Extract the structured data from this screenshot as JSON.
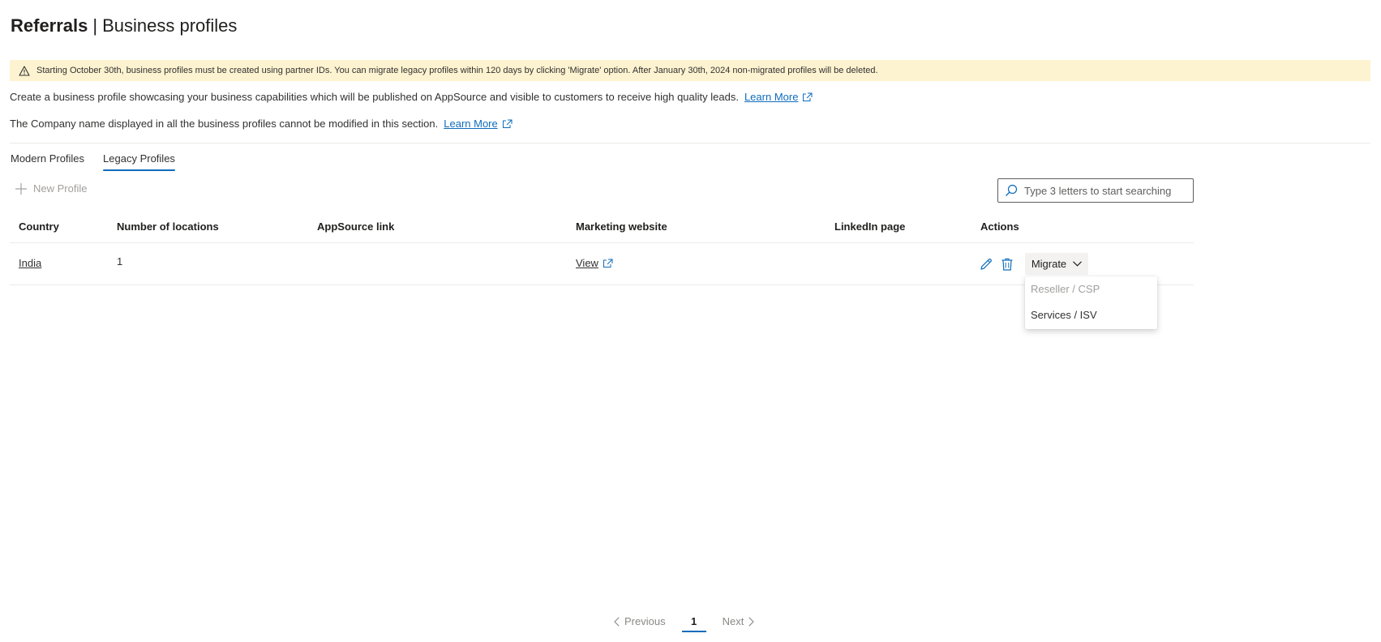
{
  "header": {
    "title_main": "Referrals",
    "title_separator": "|",
    "title_sub": "Business profiles"
  },
  "warning": {
    "icon": "warning-triangle-icon",
    "text": "Starting October 30th, business profiles must be created using partner IDs. You can migrate legacy profiles within 120 days by clicking 'Migrate' option. After January 30th, 2024 non-migrated profiles will be deleted."
  },
  "info": {
    "line1": "Create a business profile showcasing your business capabilities which will be published on AppSource and visible to customers to receive high quality leads.",
    "line1_link": "Learn More",
    "line2": "The Company name displayed in all the business profiles cannot be modified in this section.",
    "line2_link": "Learn More"
  },
  "tabs": [
    {
      "label": "Modern Profiles",
      "active": false
    },
    {
      "label": "Legacy Profiles",
      "active": true
    }
  ],
  "toolbar": {
    "new_profile_label": "New Profile",
    "search_placeholder": "Type 3 letters to start searching"
  },
  "table": {
    "columns": [
      "Country",
      "Number of locations",
      "AppSource link",
      "Marketing website",
      "LinkedIn page",
      "Actions"
    ],
    "rows": [
      {
        "country": "India",
        "locations": "1",
        "appsource_link": "",
        "marketing_website": "View",
        "linkedin_page": ""
      }
    ]
  },
  "actions": {
    "edit_icon": "pencil-icon",
    "delete_icon": "trash-icon",
    "migrate_label": "Migrate",
    "migrate_options": [
      {
        "label": "Reseller / CSP",
        "disabled": true
      },
      {
        "label": "Services / ISV",
        "disabled": false
      }
    ]
  },
  "pagination": {
    "previous_label": "Previous",
    "current_page": "1",
    "next_label": "Next"
  },
  "colors": {
    "accent": "#0f6cbd",
    "warning_bg": "#fdf3d1",
    "disabled_text": "#a19f9d"
  }
}
